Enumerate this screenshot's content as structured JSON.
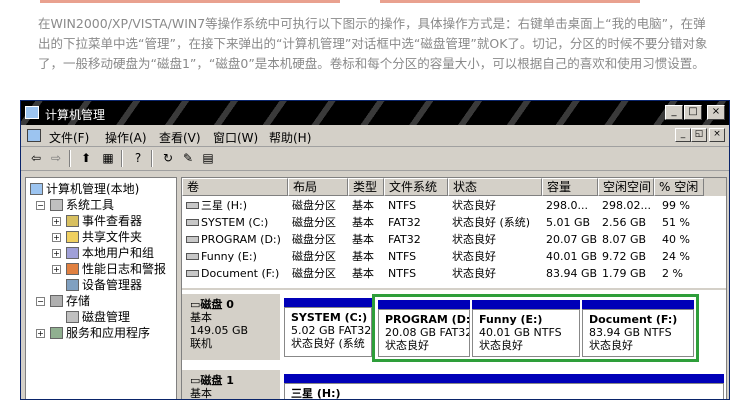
{
  "instruction": {
    "text": "在WIN2000/XP/VISTA/WIN7等操作系统中可执行以下图示的操作，具体操作方式是：右键单击桌面上“我的电脑”，在弹出的下拉菜单中选“管理”，在接下来弹出的“计算机管理”对话框中选“磁盘管理”就OK了。切记，分区的时候不要分错对象了，一般移动硬盘为“磁盘1”，“磁盘0”是本机硬盘。卷标和每个分区的容量大小，可以根据自己的喜欢和使用习惯设置。"
  },
  "window": {
    "title": "计算机管理",
    "minimize": "_",
    "maximize": "□",
    "close": "×",
    "mdi_minimize": "_",
    "mdi_restore": "◱",
    "mdi_close": "×"
  },
  "menu": {
    "file": "文件(F)",
    "action": "操作(A)",
    "view": "查看(V)",
    "window": "窗口(W)",
    "help": "帮助(H)"
  },
  "tree": {
    "root": "计算机管理(本地)",
    "system_tools": "系统工具",
    "event_viewer": "事件查看器",
    "shared_folders": "共享文件夹",
    "local_users": "本地用户和组",
    "perf_logs": "性能日志和警报",
    "device_manager": "设备管理器",
    "storage": "存储",
    "disk_management": "磁盘管理",
    "services": "服务和应用程序"
  },
  "volume_list": {
    "headers": [
      "卷",
      "布局",
      "类型",
      "文件系统",
      "状态",
      "容量",
      "空闲空间",
      "% 空闲"
    ],
    "rows": [
      [
        "三星 (H:)",
        "磁盘分区",
        "基本",
        "NTFS",
        "状态良好",
        "298.0...",
        "298.02...",
        "99 %"
      ],
      [
        "SYSTEM (C:)",
        "磁盘分区",
        "基本",
        "FAT32",
        "状态良好 (系统)",
        "5.01 GB",
        "2.56 GB",
        "51 %"
      ],
      [
        "PROGRAM (D:)",
        "磁盘分区",
        "基本",
        "FAT32",
        "状态良好",
        "20.07 GB",
        "8.07 GB",
        "40 %"
      ],
      [
        "Funny (E:)",
        "磁盘分区",
        "基本",
        "NTFS",
        "状态良好",
        "40.01 GB",
        "9.72 GB",
        "24 %"
      ],
      [
        "Document (F:)",
        "磁盘分区",
        "基本",
        "NTFS",
        "状态良好",
        "83.94 GB",
        "1.79 GB",
        "2 %"
      ]
    ]
  },
  "disks": [
    {
      "name": "磁盘 0",
      "type": "基本",
      "size": "149.05 GB",
      "status": "联机",
      "partitions": [
        {
          "name": "SYSTEM (C:)",
          "info": "5.02 GB FAT32",
          "status": "状态良好 (系统"
        },
        {
          "name": "PROGRAM (D:)",
          "info": "20.08 GB FAT32",
          "status": "状态良好"
        },
        {
          "name": "Funny (E:)",
          "info": "40.01 GB NTFS",
          "status": "状态良好"
        },
        {
          "name": "Document (F:)",
          "info": "83.94 GB NTFS",
          "status": "状态良好"
        }
      ]
    },
    {
      "name": "磁盘 1",
      "type": "基本",
      "partitions": [
        {
          "name": "三星 (H:)"
        }
      ]
    }
  ],
  "colors": {
    "partition_strip": "#0000b8",
    "highlight_box": "#2e9e3a"
  }
}
